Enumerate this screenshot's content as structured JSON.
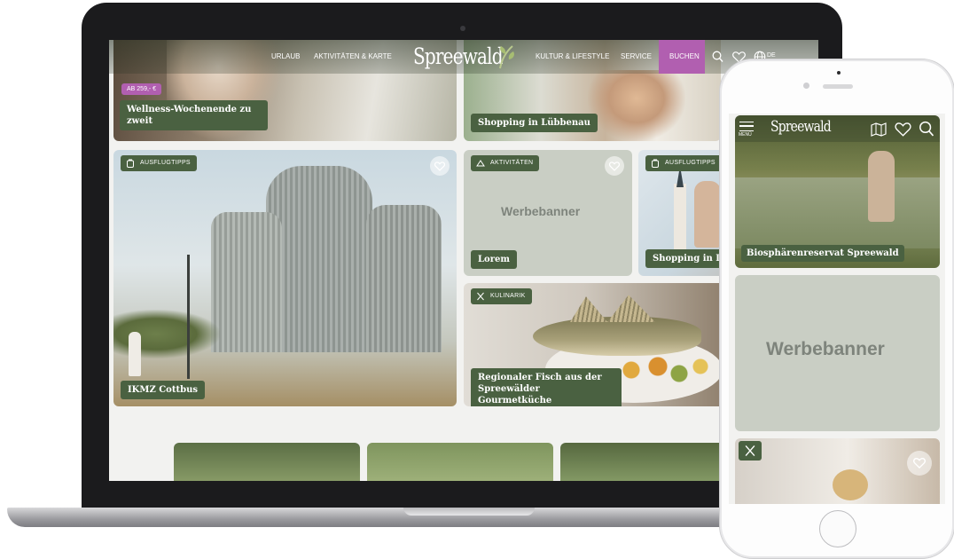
{
  "nav": {
    "logo": "Spreewald",
    "left_items": [
      "URLAUB",
      "AKTIVITÄTEN & KARTE"
    ],
    "right_items": [
      "KULTUR & LIFESTYLE",
      "SERVICE"
    ],
    "cta": "BUCHEN",
    "lang": "DE"
  },
  "cards": {
    "wellness": {
      "price_badge": "AB 259,- €",
      "title": "Wellness-Wochenende zu zweit"
    },
    "shopping_top": {
      "title": "Shopping in Lübbenau"
    },
    "ikmz": {
      "category": "AUSFLUGTIPPS",
      "title": "IKMZ Cottbus"
    },
    "ad": {
      "category": "AKTIVITÄTEN",
      "banner": "Werbebanner",
      "title": "Lorem"
    },
    "luebben": {
      "category": "AUSFLUGTIPPS",
      "title": "Shopping in L"
    },
    "fisch": {
      "category": "KULINARIK",
      "title": "Regionaler Fisch aus der Spreewälder Gourmetküche"
    }
  },
  "phone": {
    "logo": "Spreewald",
    "menu_label": "MENÜ",
    "hero_title": "Biosphärenreservat Spreewald",
    "banner": "Werbebanner"
  },
  "colors": {
    "brand_green": "#4a6141",
    "cta_pink": "#b15fb0",
    "banner_grey": "#c9cec4"
  }
}
